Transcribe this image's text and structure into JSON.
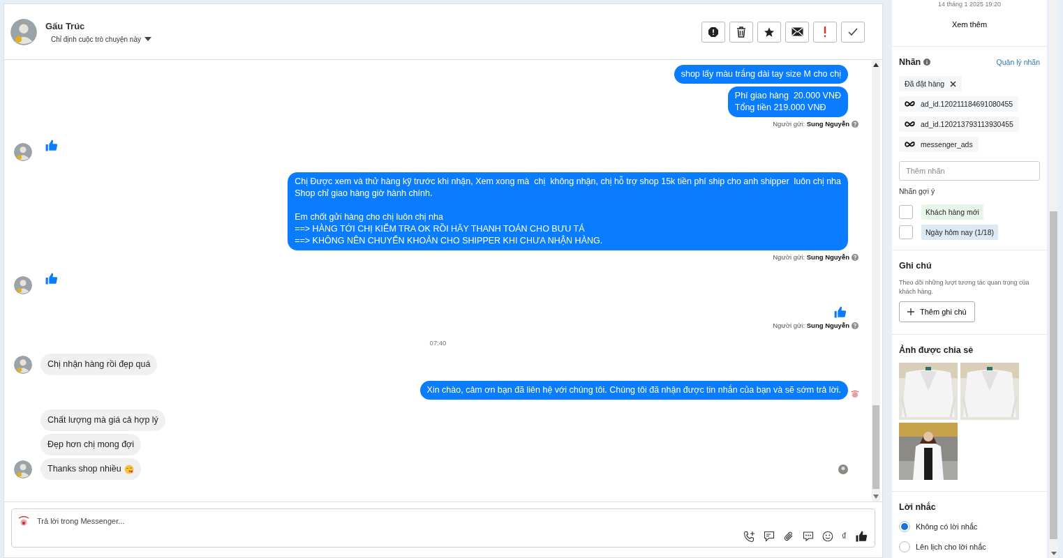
{
  "contact": {
    "name": "Gấu Trúc",
    "assign": "Chỉ định cuộc trò chuyện này"
  },
  "messages": [
    {
      "kind": "out",
      "text": "shop lấy màu trắng dài tay size M cho chị",
      "status_icon": false
    },
    {
      "kind": "out",
      "text": "Phí giao hàng  20.000 VNĐ\nTổng tiền 219.000 VNĐ",
      "status_icon": false
    },
    {
      "kind": "sender",
      "label": "Người gửi:",
      "name": "Sung Nguyễn"
    },
    {
      "kind": "like_in"
    },
    {
      "kind": "out",
      "text": "Chị Được xem và thử hàng kỹ trước khi nhận, Xem xong mà  chị  không nhận, chị hỗ trợ shop 15k tiền phí ship cho anh shipper  luôn chị nha\nShop chỉ giao hàng giờ hành chính.\n\nEm chốt gửi hàng cho chị luôn chị nha\n==> HÀNG TỚI CHỊ KIỂM TRA OK RỒI HÃY THANH TOÁN CHO BƯU TÁ\n==> KHÔNG NÊN CHUYỂN KHOẢN CHO SHIPPER KHI CHƯA NHẬN HÀNG.",
      "status_icon": false
    },
    {
      "kind": "sender",
      "label": "Người gửi:",
      "name": "Sung Nguyễn"
    },
    {
      "kind": "like_in"
    },
    {
      "kind": "like_out"
    },
    {
      "kind": "sender",
      "label": "Người gửi:",
      "name": "Sung Nguyễn"
    },
    {
      "kind": "time",
      "text": "07:40"
    },
    {
      "kind": "in",
      "text": "Chị nhận hàng rồi đẹp quá",
      "avatar": true,
      "emoji": false,
      "seen": false
    },
    {
      "kind": "out",
      "text": "Xin chào, cảm ơn bạn đã liên hệ với chúng tôi. Chúng tôi đã nhận được tin nhắn của bạn và sẽ sớm trả lời.",
      "status_icon": true
    },
    {
      "kind": "in",
      "text": "Chất lượng mà giá cả hợp lý",
      "avatar": false,
      "emoji": false,
      "seen": false
    },
    {
      "kind": "in",
      "text": "Đẹp hơn chị mong đợi",
      "avatar": false,
      "emoji": false,
      "seen": false
    },
    {
      "kind": "in",
      "text": "Thanks shop nhiều",
      "avatar": true,
      "emoji": true,
      "seen": true
    }
  ],
  "composer": {
    "placeholder": "Trả lời trong Messenger...",
    "currency_symbol": "₫"
  },
  "sidebar": {
    "date": "14 tháng 1 2025 19:20",
    "more": "Xem thêm",
    "labels": {
      "title": "Nhãn",
      "manage": "Quản lý nhãn",
      "tags": [
        {
          "kind": "removable",
          "text": "Đã đặt hàng"
        },
        {
          "kind": "meta",
          "text": "ad_id.120211184691080455"
        },
        {
          "kind": "meta",
          "text": "ad_id.120213793113930455"
        },
        {
          "kind": "meta",
          "text": "messenger_ads"
        }
      ],
      "placeholder": "Thêm nhãn",
      "suggest_title": "Nhãn gợi ý",
      "suggestions": [
        {
          "text": "Khách hàng mới",
          "color": "#e8f6ea",
          "checked": false
        },
        {
          "text": "Ngày hôm nay (1/18)",
          "color": "#dde9f5",
          "checked": false
        }
      ]
    },
    "notes": {
      "title": "Ghi chú",
      "description": "Theo dõi những lượt tương tác quan trọng của khách hàng.",
      "button": "Thêm ghi chú"
    },
    "photos": {
      "title": "Ảnh được chia sẻ"
    },
    "reminders": {
      "title": "Lời nhắc",
      "options": [
        {
          "label": "Không có lời nhắc",
          "selected": true
        },
        {
          "label": "Lên lịch cho lời nhắc",
          "selected": false
        }
      ]
    }
  }
}
